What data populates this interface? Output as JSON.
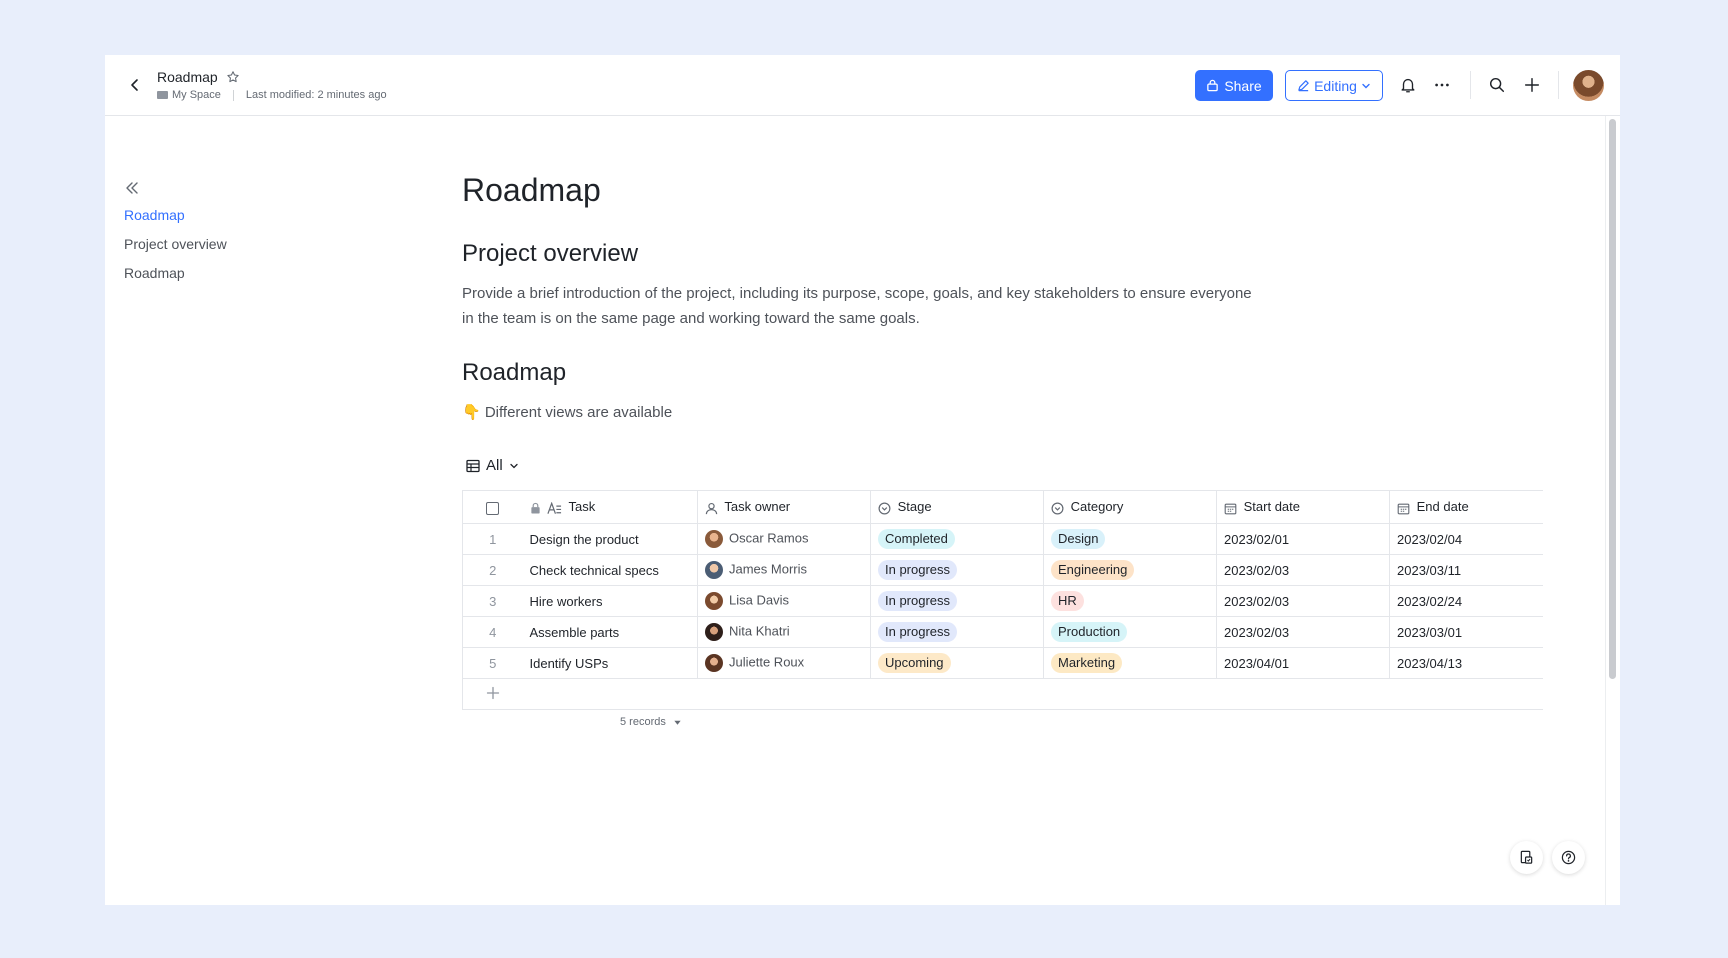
{
  "header": {
    "doc_title": "Roadmap",
    "location": "My Space",
    "last_modified": "Last modified: 2 minutes ago",
    "share_label": "Share",
    "editing_label": "Editing"
  },
  "toc": {
    "items": [
      {
        "label": "Roadmap",
        "active": true
      },
      {
        "label": "Project overview",
        "active": false
      },
      {
        "label": "Roadmap",
        "active": false
      }
    ]
  },
  "doc": {
    "title": "Roadmap",
    "overview_heading": "Project overview",
    "overview_text": "Provide a brief introduction of the project, including its purpose, scope, goals, and key stakeholders to ensure everyone in the team is on the same page and working toward the same goals.",
    "roadmap_heading": "Roadmap",
    "views_note": "👇 Different views are available"
  },
  "table": {
    "view_label": "All",
    "columns": [
      "Task",
      "Task owner",
      "Stage",
      "Category",
      "Start date",
      "End date"
    ],
    "rows": [
      {
        "num": "1",
        "task": "Design the product",
        "owner": "Oscar Ramos",
        "stage": "Completed",
        "category": "Design",
        "start": "2023/02/01",
        "end": "2023/02/04"
      },
      {
        "num": "2",
        "task": "Check technical specs",
        "owner": "James Morris",
        "stage": "In progress",
        "category": "Engineering",
        "start": "2023/02/03",
        "end": "2023/03/11"
      },
      {
        "num": "3",
        "task": "Hire workers",
        "owner": "Lisa Davis",
        "stage": "In progress",
        "category": "HR",
        "start": "2023/02/03",
        "end": "2023/02/24"
      },
      {
        "num": "4",
        "task": "Assemble parts",
        "owner": "Nita Khatri",
        "stage": "In progress",
        "category": "Production",
        "start": "2023/02/03",
        "end": "2023/03/01"
      },
      {
        "num": "5",
        "task": "Identify USPs",
        "owner": "Juliette Roux",
        "stage": "Upcoming",
        "category": "Marketing",
        "start": "2023/04/01",
        "end": "2023/04/13"
      }
    ],
    "records_label": "5 records"
  },
  "colors": {
    "accent": "#3370ff",
    "background": "#e8eefb",
    "stage_completed": "#d6f4f8",
    "stage_in_progress": "#e1e8fb",
    "stage_upcoming": "#fdebc8",
    "cat_design": "#d9f1fa",
    "cat_engineering": "#fde3c8",
    "cat_hr": "#fde1df",
    "cat_production": "#d6f4f8",
    "cat_marketing": "#fde9c4"
  },
  "icons": {
    "back": "chevron-left-icon",
    "star": "star-icon",
    "share": "lock-share-icon",
    "edit": "pencil-icon",
    "bell": "bell-icon",
    "more": "more-horizontal-icon",
    "search": "search-icon",
    "add": "plus-icon",
    "collapse": "double-chevron-left-icon",
    "grid": "table-grid-icon",
    "float_1": "doc-tool-icon",
    "float_2": "help-icon"
  }
}
